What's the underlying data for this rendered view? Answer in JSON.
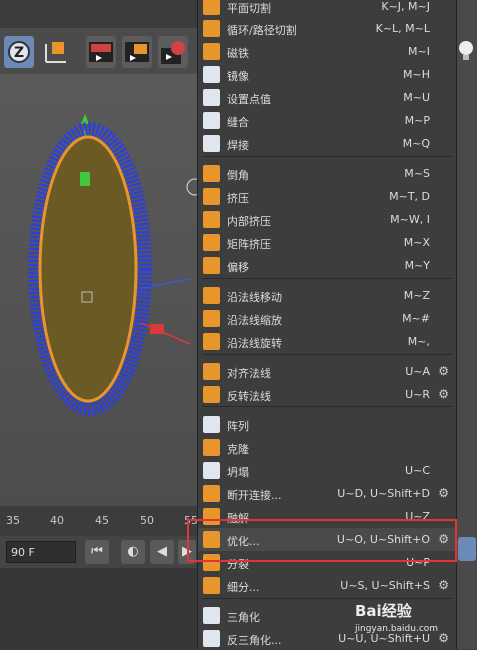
{
  "timeline": {
    "ticks": [
      "35",
      "40",
      "45",
      "50",
      "55"
    ],
    "frame": "90 F"
  },
  "menu": {
    "items": [
      {
        "label": "平面切割",
        "shortcut": "K~J, M~J",
        "gear": false
      },
      {
        "label": "循环/路径切割",
        "shortcut": "K~L, M~L",
        "gear": false
      },
      {
        "label": "磁铁",
        "shortcut": "M~I",
        "gear": false
      },
      {
        "label": "镜像",
        "shortcut": "M~H",
        "gear": false
      },
      {
        "label": "设置点值",
        "shortcut": "M~U",
        "gear": false
      },
      {
        "label": "缝合",
        "shortcut": "M~P",
        "gear": false
      },
      {
        "label": "焊接",
        "shortcut": "M~Q",
        "gear": false
      },
      {
        "label": "倒角",
        "shortcut": "M~S",
        "gear": false
      },
      {
        "label": "挤压",
        "shortcut": "M~T, D",
        "gear": false
      },
      {
        "label": "内部挤压",
        "shortcut": "M~W, I",
        "gear": false
      },
      {
        "label": "矩阵挤压",
        "shortcut": "M~X",
        "gear": false
      },
      {
        "label": "偏移",
        "shortcut": "M~Y",
        "gear": false
      },
      {
        "label": "沿法线移动",
        "shortcut": "M~Z",
        "gear": false
      },
      {
        "label": "沿法线缩放",
        "shortcut": "M~#",
        "gear": false
      },
      {
        "label": "沿法线旋转",
        "shortcut": "M~,",
        "gear": false
      },
      {
        "label": "对齐法线",
        "shortcut": "U~A",
        "gear": true
      },
      {
        "label": "反转法线",
        "shortcut": "U~R",
        "gear": true
      },
      {
        "label": "阵列",
        "shortcut": "",
        "gear": false
      },
      {
        "label": "克隆",
        "shortcut": "",
        "gear": false
      },
      {
        "label": "坍塌",
        "shortcut": "U~C",
        "gear": false
      },
      {
        "label": "断开连接...",
        "shortcut": "U~D, U~Shift+D",
        "gear": true
      },
      {
        "label": "融解",
        "shortcut": "U~Z",
        "gear": false
      },
      {
        "label": "优化...",
        "shortcut": "U~O, U~Shift+O",
        "gear": true
      },
      {
        "label": "分裂",
        "shortcut": "U~P",
        "gear": false
      },
      {
        "label": "细分...",
        "shortcut": "U~S, U~Shift+S",
        "gear": true
      },
      {
        "label": "三角化",
        "shortcut": "",
        "gear": false
      },
      {
        "label": "反三角化...",
        "shortcut": "U~U, U~Shift+U",
        "gear": true
      }
    ]
  },
  "watermark": {
    "brand": "Bai经验",
    "url": "jingyan.baidu.com"
  },
  "colors": {
    "highlight": "#e0333a",
    "menu_bg": "#3d3d3d",
    "icon_orange": "#e8962b"
  },
  "icons": [
    "knife-icon",
    "loop-cut-icon",
    "magnet-icon",
    "mirror-icon",
    "set-point-icon",
    "stitch-icon",
    "weld-icon",
    "bevel-icon",
    "extrude-icon",
    "inner-extrude-icon",
    "matrix-extrude-icon",
    "offset-icon",
    "normal-move-icon",
    "normal-scale-icon",
    "normal-rotate-icon",
    "align-normals-icon",
    "reverse-normals-icon",
    "array-icon",
    "clone-icon",
    "collapse-icon",
    "disconnect-icon",
    "dissolve-icon",
    "optimize-icon",
    "split-icon",
    "subdivide-icon",
    "triangulate-icon",
    "untriangulate-icon"
  ]
}
